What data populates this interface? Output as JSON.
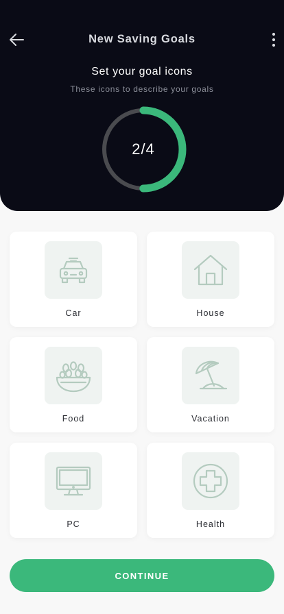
{
  "header": {
    "title": "New Saving Goals",
    "subtitle": "Set your goal icons",
    "hint": "These icons to describe your goals",
    "back_icon": "arrow-left-icon",
    "menu_icon": "more-vertical-icon"
  },
  "progress": {
    "label": "2/4",
    "current": 2,
    "total": 4,
    "fraction": 0.5,
    "track_color": "#4a4b4f",
    "fill_color": "#3bb87b"
  },
  "goals": [
    {
      "label": "Car",
      "icon": "car-icon"
    },
    {
      "label": "House",
      "icon": "house-icon"
    },
    {
      "label": "Food",
      "icon": "food-bowl-icon"
    },
    {
      "label": "Vacation",
      "icon": "beach-umbrella-icon"
    },
    {
      "label": "PC",
      "icon": "monitor-icon"
    },
    {
      "label": "Health",
      "icon": "health-cross-icon"
    }
  ],
  "continue_label": "CONTINUE",
  "colors": {
    "header_bg": "#0a0b16",
    "accent": "#3bb87b",
    "icon_stroke": "#b4cbbf",
    "icon_tile_bg": "#eff3f1"
  }
}
